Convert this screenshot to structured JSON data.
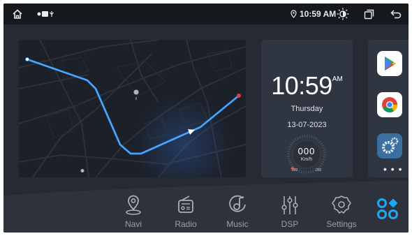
{
  "status_bar": {
    "time": "10:59 AM",
    "icons": [
      "home-icon",
      "notification-icons",
      "location-icon",
      "brightness-icon",
      "recent-apps-icon",
      "back-icon"
    ]
  },
  "map_widget": {
    "route_color": "#2f8be8",
    "destination_color": "#e8374a"
  },
  "clock_widget": {
    "time": "10:59",
    "ampm": "AM",
    "day": "Thursday",
    "date": "13-07-2023"
  },
  "speedometer": {
    "speed": "000",
    "unit": "Km/h",
    "min_label": "000",
    "max_label": "260"
  },
  "app_shortcuts": {
    "items": [
      "play-store-icon",
      "chrome-icon",
      "settings-gear-icon"
    ],
    "more": "• • •"
  },
  "dock": {
    "items": [
      {
        "label": "Navi",
        "icon": "map-pin-icon"
      },
      {
        "label": "Radio",
        "icon": "radio-icon"
      },
      {
        "label": "Music",
        "icon": "music-disc-icon"
      },
      {
        "label": "DSP",
        "icon": "equalizer-icon"
      },
      {
        "label": "Settings",
        "icon": "gear-icon"
      }
    ],
    "all_apps_icon": "apps-grid-icon",
    "accent": "#1ea8f0"
  }
}
